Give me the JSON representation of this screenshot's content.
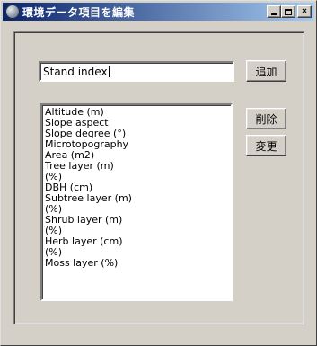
{
  "window": {
    "title": "環境データ項目を編集",
    "controls": {
      "minimize": "minimize",
      "maximize": "maximize",
      "close": "×"
    }
  },
  "input": {
    "value": "Stand index"
  },
  "buttons": {
    "add": "追加",
    "delete": "削除",
    "change": "変更"
  },
  "list": {
    "items": [
      "Altitude (m)",
      "Slope aspect",
      "Slope degree (°)",
      "Microtopography",
      "Area (m2)",
      "Tree layer (m)",
      "(%)",
      "DBH (cm)",
      "Subtree layer (m)",
      "(%)",
      "Shrub layer (m)",
      "(%)",
      "Herb layer (cm)",
      "(%)",
      "Moss layer (%)"
    ]
  }
}
